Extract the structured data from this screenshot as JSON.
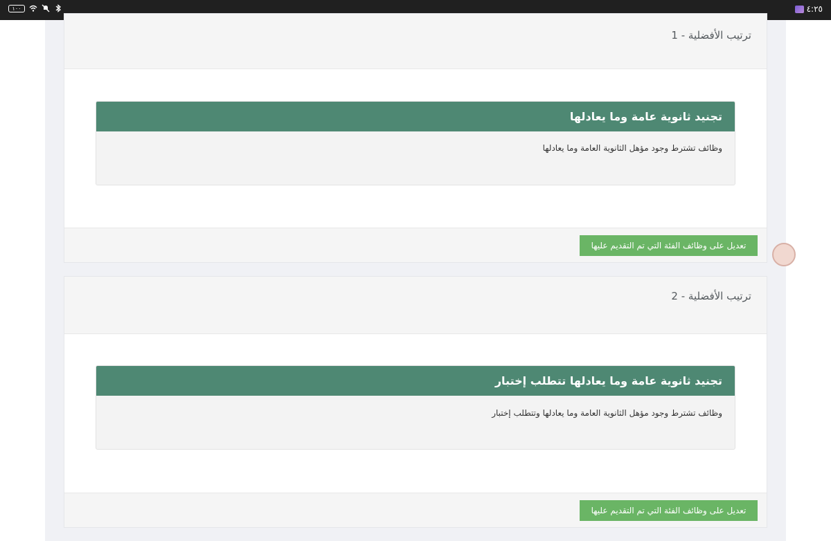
{
  "status_bar": {
    "battery": "١٠٠",
    "time": "٤:٢٥",
    "icons": [
      "battery-icon",
      "wifi-icon",
      "mute-icon",
      "bluetooth-icon",
      "app-notification-icon"
    ]
  },
  "preferences": [
    {
      "rank_label": "ترتيب الأفضلية - 1",
      "category_title": "تجنيد ثانوية عامة وما يعادلها",
      "category_description": "وظائف تشترط وجود مؤهل الثانوية العامة وما يعادلها",
      "edit_button_label": "تعديل على وظائف الفئة التي تم التقديم عليها"
    },
    {
      "rank_label": "ترتيب الأفضلية - 2",
      "category_title": "تجنيد ثانوية عامة وما يعادلها تتطلب إختبار",
      "category_description": "وظائف تشترط وجود مؤهل الثانوية العامة وما يعادلها وتتطلب إختبار",
      "edit_button_label": "تعديل على وظائف الفئة التي تم التقديم عليها"
    }
  ],
  "colors": {
    "card_header": "#4e8873",
    "button": "#6ab565",
    "status_bar": "#202020"
  }
}
